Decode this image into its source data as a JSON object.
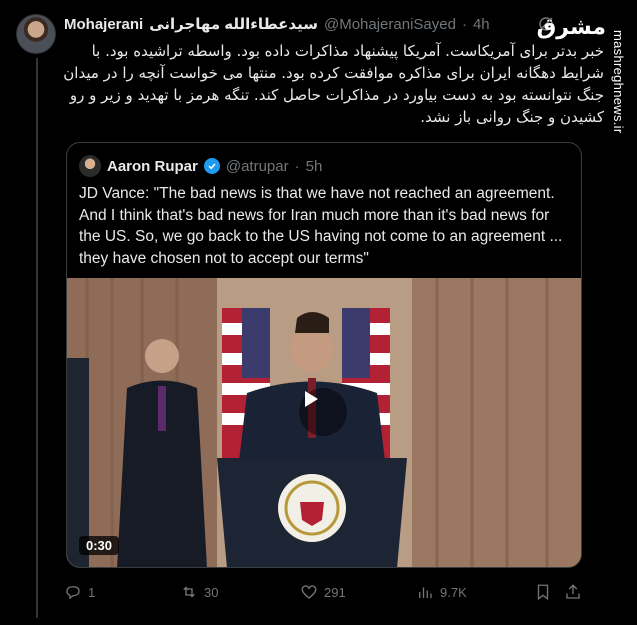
{
  "author": {
    "name_en": "Mohajerani",
    "name_fa": "سیدعطاءالله مهاجرانی",
    "handle": "@MohajeraniSayed",
    "separator": "·",
    "time": "4h"
  },
  "tweet_text": "خبر بدتر برای آمریکاست. آمریکا پیشنهاد مذاکرات داده بود. واسطه تراشیده بود. با شرایط دهگانه ایران برای مذاکره موافقت کرده بود. منتها می خواست آنچه را در میدان جنگ نتوانسته بود به دست بیاورد در مذاکرات حاصل کند. تنگه هرمز با تهدید و زیر و رو کشیدن و جنگ روانی باز نشد.",
  "site_logo": "مشرق",
  "watermark": "mashreghnews.ir",
  "quoted": {
    "name": "Aaron Rupar",
    "handle": "@atrupar",
    "separator": "·",
    "time": "5h",
    "text": "JD Vance: \"The bad news is that we have not reached an agreement. And I think that's bad news for Iran much more than it's bad news for the US. So, we go back to the US having not come to an agreement ... they have chosen not to accept our terms\"",
    "video_duration": "0:30"
  },
  "actions": {
    "replies": "1",
    "reposts": "30",
    "likes": "291",
    "views": "9.7K"
  },
  "colors": {
    "background": "#000000",
    "text": "#e7e9ea",
    "muted": "#71767b",
    "verified": "#1d9bf0"
  }
}
